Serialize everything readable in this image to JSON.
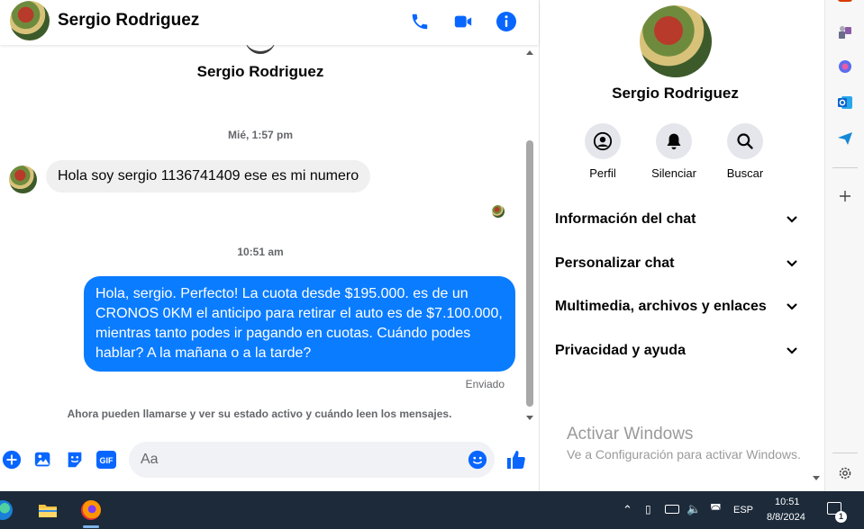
{
  "header": {
    "contact_name": "Sergio Rodriguez"
  },
  "chat": {
    "top_name": "Sergio Rodriguez",
    "timestamp_1": "Mié, 1:57 pm",
    "incoming_message": "Hola soy sergio 1136741409 ese es mi numero",
    "timestamp_2": "10:51 am",
    "outgoing_message": "Hola, sergio. Perfecto! La cuota desde $195.000. es de un CRONOS 0KM el anticipo para retirar el auto es de $7.100.000, mientras tanto podes ir pagando en cuotas. Cuándo podes hablar? A la mañana o a la tarde?",
    "status": "Enviado",
    "notice": "Ahora pueden llamarse y ver su estado activo y cuándo leen los mensajes."
  },
  "composer": {
    "placeholder": "Aa"
  },
  "panel": {
    "name": "Sergio Rodriguez",
    "actions": [
      {
        "label": "Perfil",
        "icon": "profile-icon"
      },
      {
        "label": "Silenciar",
        "icon": "bell-icon"
      },
      {
        "label": "Buscar",
        "icon": "search-icon"
      }
    ],
    "sections": [
      {
        "label": "Información del chat"
      },
      {
        "label": "Personalizar chat"
      },
      {
        "label": "Multimedia, archivos y enlaces"
      },
      {
        "label": "Privacidad y ayuda"
      }
    ],
    "watermark_title": "Activar Windows",
    "watermark_sub": "Ve a Configuración para activar Windows."
  },
  "taskbar": {
    "time": "10:51",
    "date": "8/8/2024",
    "lang": "ESP",
    "notif_count": "1"
  },
  "colors": {
    "accent": "#0a7cff",
    "messenger_blue": "#0866ff",
    "taskbar": "#1c2a3a"
  }
}
